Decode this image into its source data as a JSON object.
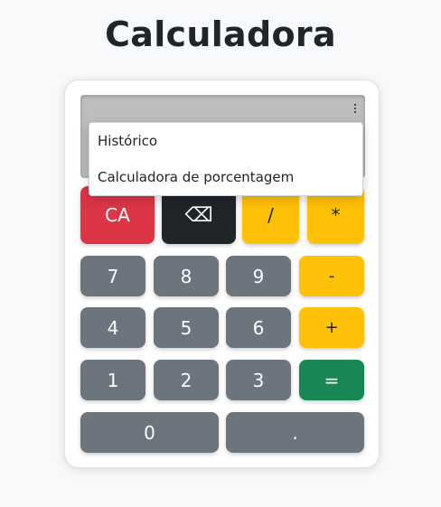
{
  "page": {
    "title": "Calculadora"
  },
  "menu": {
    "items": [
      {
        "label": "Histórico"
      },
      {
        "label": "Calculadora de porcentagem"
      }
    ]
  },
  "keypad": {
    "clear": "CA",
    "backspace": "⌫",
    "divide": "/",
    "multiply": "*",
    "seven": "7",
    "eight": "8",
    "nine": "9",
    "minus": "-",
    "four": "4",
    "five": "5",
    "six": "6",
    "plus": "+",
    "one": "1",
    "two": "2",
    "three": "3",
    "equals": "=",
    "zero": "0",
    "decimal": "."
  },
  "colors": {
    "danger": "#dc3545",
    "dark": "#212529",
    "warning": "#ffc107",
    "secondary": "#6c757d",
    "success": "#198754",
    "display": "#bdbdbd"
  },
  "icons": {
    "menu": "kebab-menu-icon",
    "backspace": "backspace-icon"
  }
}
